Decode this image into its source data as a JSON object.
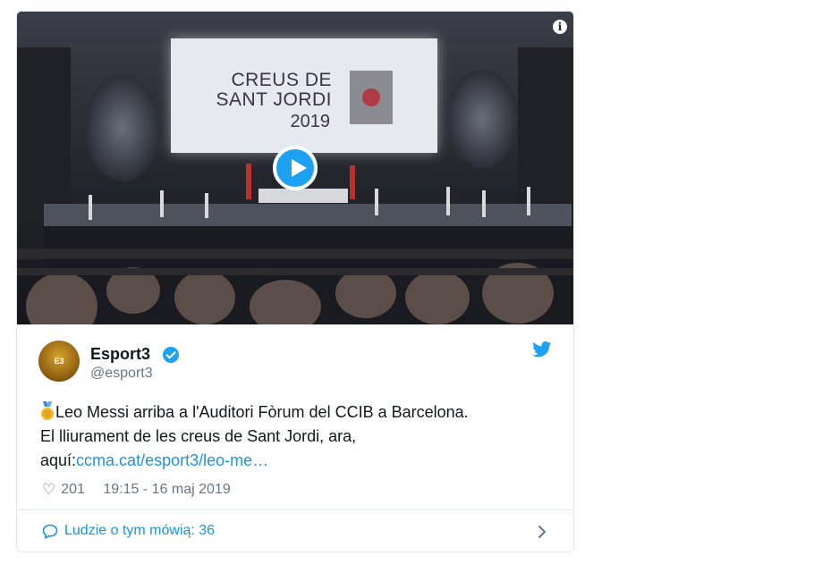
{
  "media": {
    "screen_title_line1": "CREUS DE",
    "screen_title_line2": "SANT JORDI",
    "screen_year": "2019",
    "info_icon_glyph": "i"
  },
  "author": {
    "name": "Esport3",
    "handle": "@esport3",
    "avatar_text": "E3"
  },
  "tweet": {
    "text_line1": "Leo Messi arriba a l'Auditori Fòrum del CCIB a Barcelona.",
    "text_line2": "El lliurament de les creus de Sant Jordi, ara,",
    "text_prefix": "aquí:",
    "link_text": "ccma.cat/esport3/leo-me…"
  },
  "meta": {
    "like_count": "201",
    "timestamp": "19:15 - 16 maj 2019"
  },
  "footer": {
    "label": "Ludzie o tym mówią: 36"
  },
  "icons": {
    "verified": "verified-badge-icon",
    "twitter": "twitter-bird-icon",
    "heart": "heart-icon",
    "chat": "speech-bubble-icon",
    "chevron": "chevron-right-icon",
    "play": "play-icon",
    "medal": "medal-icon"
  },
  "colors": {
    "accent": "#1da1f2",
    "link": "#1b95e0",
    "text": "#14171a",
    "muted": "#657786",
    "border": "#e1e8ed"
  }
}
